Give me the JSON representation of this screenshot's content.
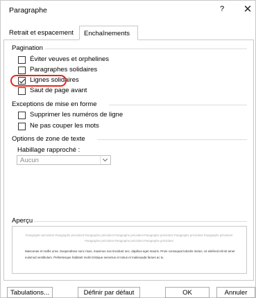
{
  "window": {
    "title": "Paragraphe",
    "help_label": "?",
    "close_label": "✕"
  },
  "tabs": [
    {
      "label": "Retrait et espacement",
      "active": false
    },
    {
      "label": "Enchaînements",
      "active": true
    }
  ],
  "pagination": {
    "title": "Pagination",
    "options": [
      {
        "label": "Éviter veuves et orphelines",
        "checked": false
      },
      {
        "label": "Paragraphes solidaires",
        "checked": false
      },
      {
        "label": "Lignes solidaires",
        "checked": true
      },
      {
        "label": "Saut de page avant",
        "checked": false
      }
    ]
  },
  "exceptions": {
    "title": "Exceptions de mise en forme",
    "options": [
      {
        "label": "Supprimer les numéros de ligne",
        "checked": false
      },
      {
        "label": "Ne pas couper les mots",
        "checked": false
      }
    ]
  },
  "textbox": {
    "title": "Options de zone de texte",
    "wrap_label": "Habillage rapproché :",
    "wrap_value": "Aucun"
  },
  "preview": {
    "title": "Aperçu",
    "prev_text": "Paragraphe précédent Paragraphe précédent Paragraphe précédent Paragraphe précédent Paragraphe précédent Paragraphe précédent Paragraphe précédent Paragraphe précédent Paragraphe précédent Paragraphe précédent",
    "body_text": "Maecenas et mollis urna. Suspendisse nunc risus, maximus non tincidunt nec, dapibus eget mauris. Proin consequat lobortis metus. Ut eleifend elit sit amet euismod vestibulum. Pellentesque habitant morbi tristique senectus et netus et malesuada fames ac tu"
  },
  "buttons": {
    "tabs_label": "Tabulations...",
    "default_label": "Définir par défaut",
    "ok_label": "OK",
    "cancel_label": "Annuler"
  },
  "colors": {
    "highlight_ring": "#e8261b"
  }
}
